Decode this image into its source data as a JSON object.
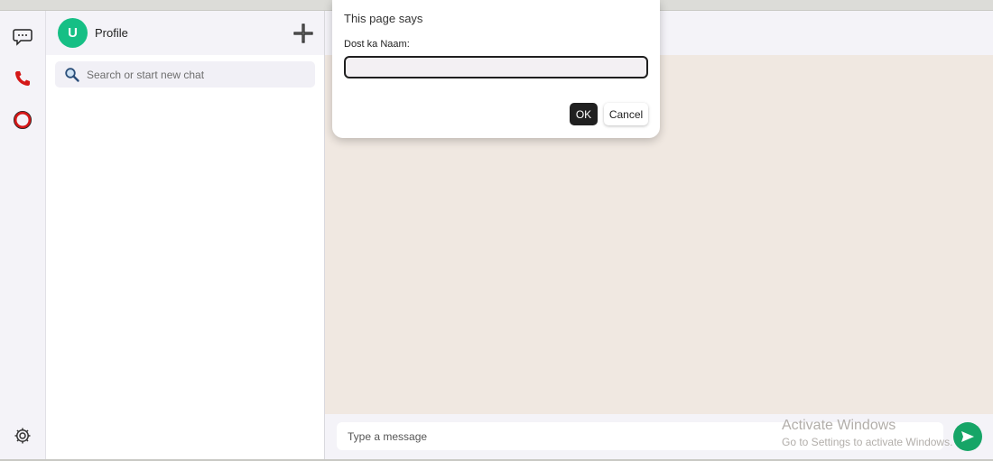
{
  "rail": {
    "icons": [
      "chat-bubble-icon",
      "phone-icon",
      "status-ring-icon",
      "settings-gear-icon"
    ]
  },
  "sidebar": {
    "avatar_letter": "U",
    "profile_label": "Profile",
    "add_icon": "plus-icon",
    "search": {
      "placeholder": "Search or start new chat",
      "icon": "search-icon"
    }
  },
  "composer": {
    "placeholder": "Type a message",
    "send_icon": "send-arrow-icon"
  },
  "watermark": {
    "title": "Activate Windows",
    "subtitle": "Go to Settings to activate Windows."
  },
  "dialog": {
    "title": "This page says",
    "message": "Dost ka Naam:",
    "input_value": "",
    "ok_label": "OK",
    "cancel_label": "Cancel"
  },
  "colors": {
    "accent_green": "#16bf85",
    "send_green": "#16a567",
    "chat_background": "#f0e8e1",
    "rail_icon_red": "#d41818"
  }
}
